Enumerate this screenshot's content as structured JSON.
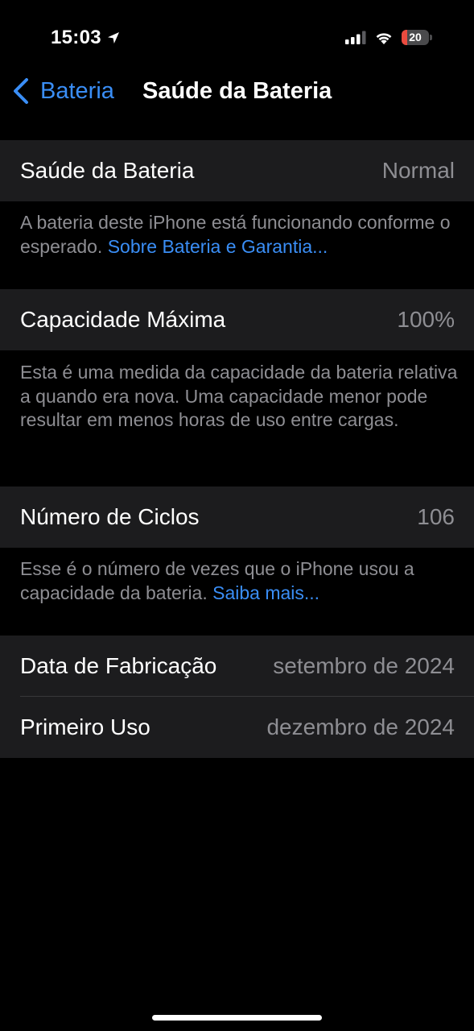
{
  "status_bar": {
    "time": "15:03",
    "battery_level": "20",
    "battery_fraction": 0.2,
    "battery_color": "#eb4b3f",
    "icons": [
      "location-arrow-icon",
      "cellular-signal-icon",
      "wifi-icon",
      "battery-icon"
    ]
  },
  "nav": {
    "back_label": "Bateria",
    "title": "Saúde da Bateria"
  },
  "sections": {
    "health": {
      "label": "Saúde da Bateria",
      "value": "Normal",
      "footer_text": "A bateria deste iPhone está funcionando conforme o esperado. ",
      "footer_link": "Sobre Bateria e Garantia..."
    },
    "capacity": {
      "label": "Capacidade Máxima",
      "value": "100%",
      "footer_text": "Esta é uma medida da capacidade da bateria relativa a quando era nova. Uma capacidade menor pode resultar em menos horas de uso entre cargas."
    },
    "cycles": {
      "label": "Número de Ciclos",
      "value": "106",
      "footer_text": "Esse é o número de vezes que o iPhone usou a capacidade da bateria. ",
      "footer_link": "Saiba mais..."
    },
    "dates": {
      "manufacture_label": "Data de Fabricação",
      "manufacture_value": "setembro de 2024",
      "first_use_label": "Primeiro Uso",
      "first_use_value": "dezembro de 2024"
    }
  },
  "colors": {
    "background": "#000000",
    "cell": "#1c1c1e",
    "accent": "#3a8ef6",
    "secondary_text": "#8e8e93",
    "separator": "#38383a"
  }
}
